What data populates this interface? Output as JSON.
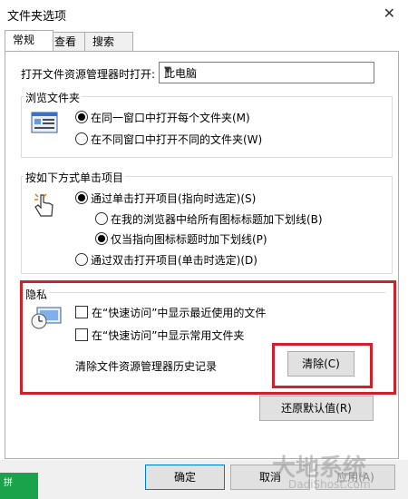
{
  "window": {
    "title": "文件夹选项"
  },
  "tabs": [
    {
      "label": "常规"
    },
    {
      "label": "查看"
    },
    {
      "label": "搜索"
    }
  ],
  "general": {
    "open_label": "打开文件资源管理器时打开:",
    "open_value": "此电脑",
    "browse": {
      "title": "浏览文件夹",
      "option_same": "在同一窗口中打开每个文件夹(M)",
      "option_new": "在不同窗口中打开不同的文件夹(W)"
    },
    "click": {
      "title": "按如下方式单击项目",
      "option_single": "通过单击打开项目(指向时选定)(S)",
      "sub_all": "在我的浏览器中给所有图标标题加下划线(B)",
      "sub_point": "仅当指向图标标题时加下划线(P)",
      "option_double": "通过双击打开项目(单击时选定)(D)"
    },
    "privacy": {
      "title": "隐私",
      "recent_files": "在“快速访问”中显示最近使用的文件",
      "frequent_folders": "在“快速访问”中显示常用文件夹",
      "clear_label": "清除文件资源管理器历史记录",
      "clear_button": "清除(C)"
    },
    "restore_button": "还原默认值(R)"
  },
  "footer": {
    "ok": "确定",
    "cancel": "取消",
    "apply": "应用(A)"
  },
  "overlay": {
    "badge_text": "拼",
    "watermark": "大地系统",
    "watermark_sub": "DadiShost.com"
  }
}
